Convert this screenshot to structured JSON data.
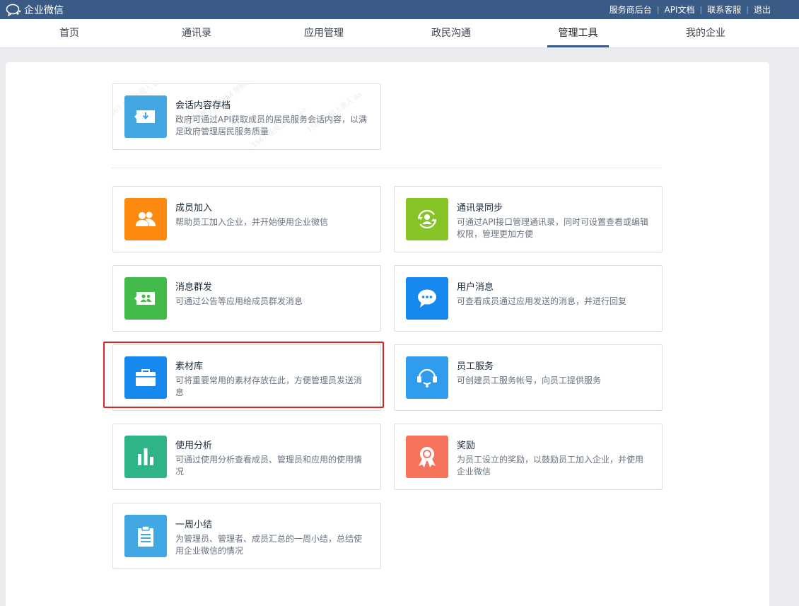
{
  "topbar": {
    "brand": "企业微信",
    "links": [
      "服务商后台",
      "API文档",
      "联系客服",
      "退出"
    ]
  },
  "nav": {
    "tabs": [
      "首页",
      "通讯录",
      "应用管理",
      "政民沟通",
      "管理工具",
      "我的企业"
    ],
    "active": "管理工具"
  },
  "watermark": "1567 居民上报人 aa",
  "archive": {
    "title": "会话内容存档",
    "desc": "政府可通过API获取成员的居民服务会话内容，以满足政府管理居民服务质量",
    "color": "#42a6e0",
    "icon": "download-icon"
  },
  "tools": [
    {
      "title": "成员加入",
      "desc": "帮助员工加入企业，并开始使用企业微信",
      "color": "#fc8a10",
      "icon": "members-icon"
    },
    {
      "title": "通讯录同步",
      "desc": "可通过API接口管理通讯录，同时可设置查看或编辑权限，管理更加方便",
      "color": "#87c426",
      "icon": "sync-contacts-icon"
    },
    {
      "title": "消息群发",
      "desc": "可通过公告等应用给成员群发消息",
      "color": "#43bb4b",
      "icon": "broadcast-icon"
    },
    {
      "title": "用户消息",
      "desc": "可查看成员通过应用发送的消息，并进行回复",
      "color": "#1589f0",
      "icon": "chat-bubble-icon"
    },
    {
      "title": "素材库",
      "desc": "可将重要常用的素材存放在此，方便管理员发送消息",
      "color": "#1589f0",
      "icon": "briefcase-icon"
    },
    {
      "title": "员工服务",
      "desc": "可创建员工服务帐号，向员工提供服务",
      "color": "#2f9cee",
      "icon": "headset-icon"
    },
    {
      "title": "使用分析",
      "desc": "可通过使用分析查看成员、管理员和应用的使用情况",
      "color": "#2fb585",
      "icon": "bar-chart-icon"
    },
    {
      "title": "奖励",
      "desc": "为员工设立的奖励，以鼓励员工加入企业，并使用企业微信",
      "color": "#f5735a",
      "icon": "award-icon"
    },
    {
      "title": "一周小结",
      "desc": "为管理员、管理者、成员汇总的一周小结，总结使用企业微信的情况",
      "color": "#40a7e2",
      "icon": "clipboard-icon"
    }
  ]
}
